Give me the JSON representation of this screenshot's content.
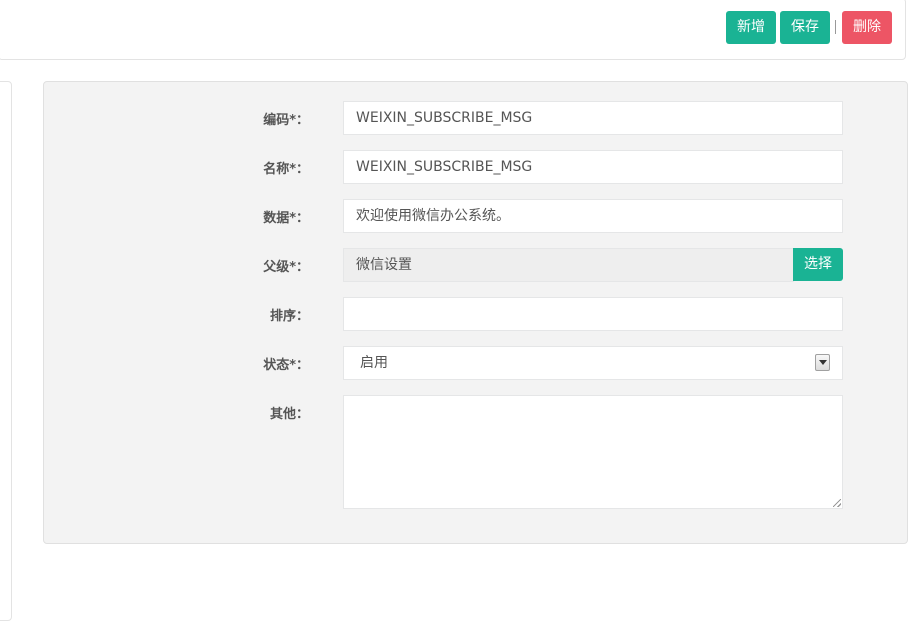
{
  "toolbar": {
    "add_label": "新增",
    "save_label": "保存",
    "delete_label": "删除"
  },
  "form": {
    "code": {
      "label": "编码*：",
      "value": "WEIXIN_SUBSCRIBE_MSG"
    },
    "name": {
      "label": "名称*：",
      "value": "WEIXIN_SUBSCRIBE_MSG"
    },
    "data": {
      "label": "数据*：",
      "value": "欢迎使用微信办公系统。"
    },
    "parent": {
      "label": "父级*：",
      "value": "微信设置",
      "choose_label": "选择"
    },
    "sort": {
      "label": "排序：",
      "value": ""
    },
    "status": {
      "label": "状态*：",
      "value": "启用"
    },
    "other": {
      "label": "其他：",
      "value": ""
    }
  },
  "colors": {
    "primary": "#1ab394",
    "danger": "#ed5565",
    "panel_bg": "#f3f3f3"
  }
}
